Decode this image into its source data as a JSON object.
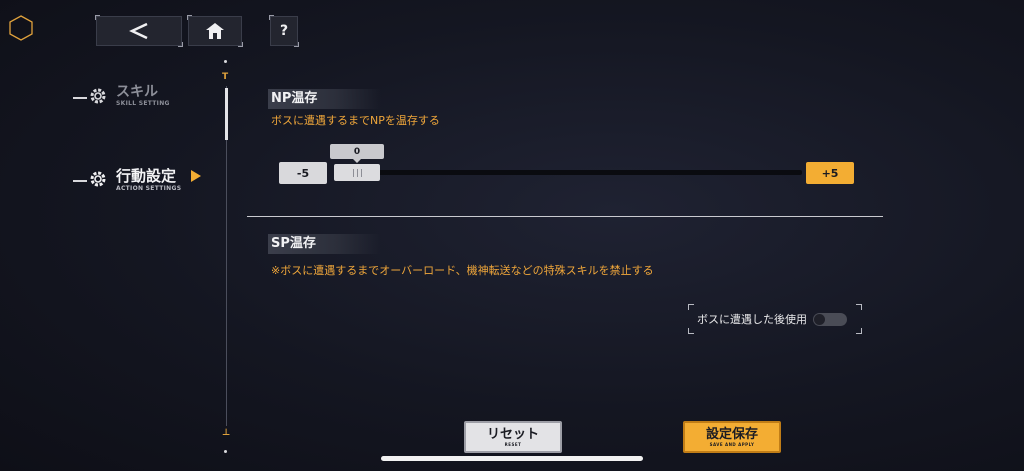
{
  "header": {
    "back_icon": "chevron-left-icon",
    "home_icon": "home-icon",
    "help_label": "?",
    "logo_icon": "hexagon-icon"
  },
  "sidebar": {
    "items": [
      {
        "label": "スキル",
        "sub": "SKILL SETTING",
        "icon": "gear-icon",
        "active": false
      },
      {
        "label": "行動設定",
        "sub": "ACTION SETTINGS",
        "icon": "gear-icon",
        "active": true
      }
    ],
    "scroll_top_mark": "T",
    "scroll_bottom_mark": "⊥"
  },
  "np_section": {
    "title": "NP温存",
    "description": "ボスに遭遇するまでNPを温存する",
    "slider": {
      "min_label": "-5",
      "max_label": "+5",
      "value_label": "0",
      "min": -5,
      "max": 5,
      "value": 0
    }
  },
  "sp_section": {
    "title": "SP温存",
    "description": "※ボスに遭遇するまでオーバーロード、機神転送などの特殊スキルを禁止する",
    "toggle": {
      "label": "ボスに遭遇した後使用",
      "on": false
    }
  },
  "footer": {
    "reset": {
      "label": "リセット",
      "sub": "RESET"
    },
    "save": {
      "label": "設定保存",
      "sub": "SAVE AND APPLY"
    }
  },
  "colors": {
    "accent": "#f3ad33",
    "text_accent": "#efa63a",
    "background": "#141621"
  }
}
